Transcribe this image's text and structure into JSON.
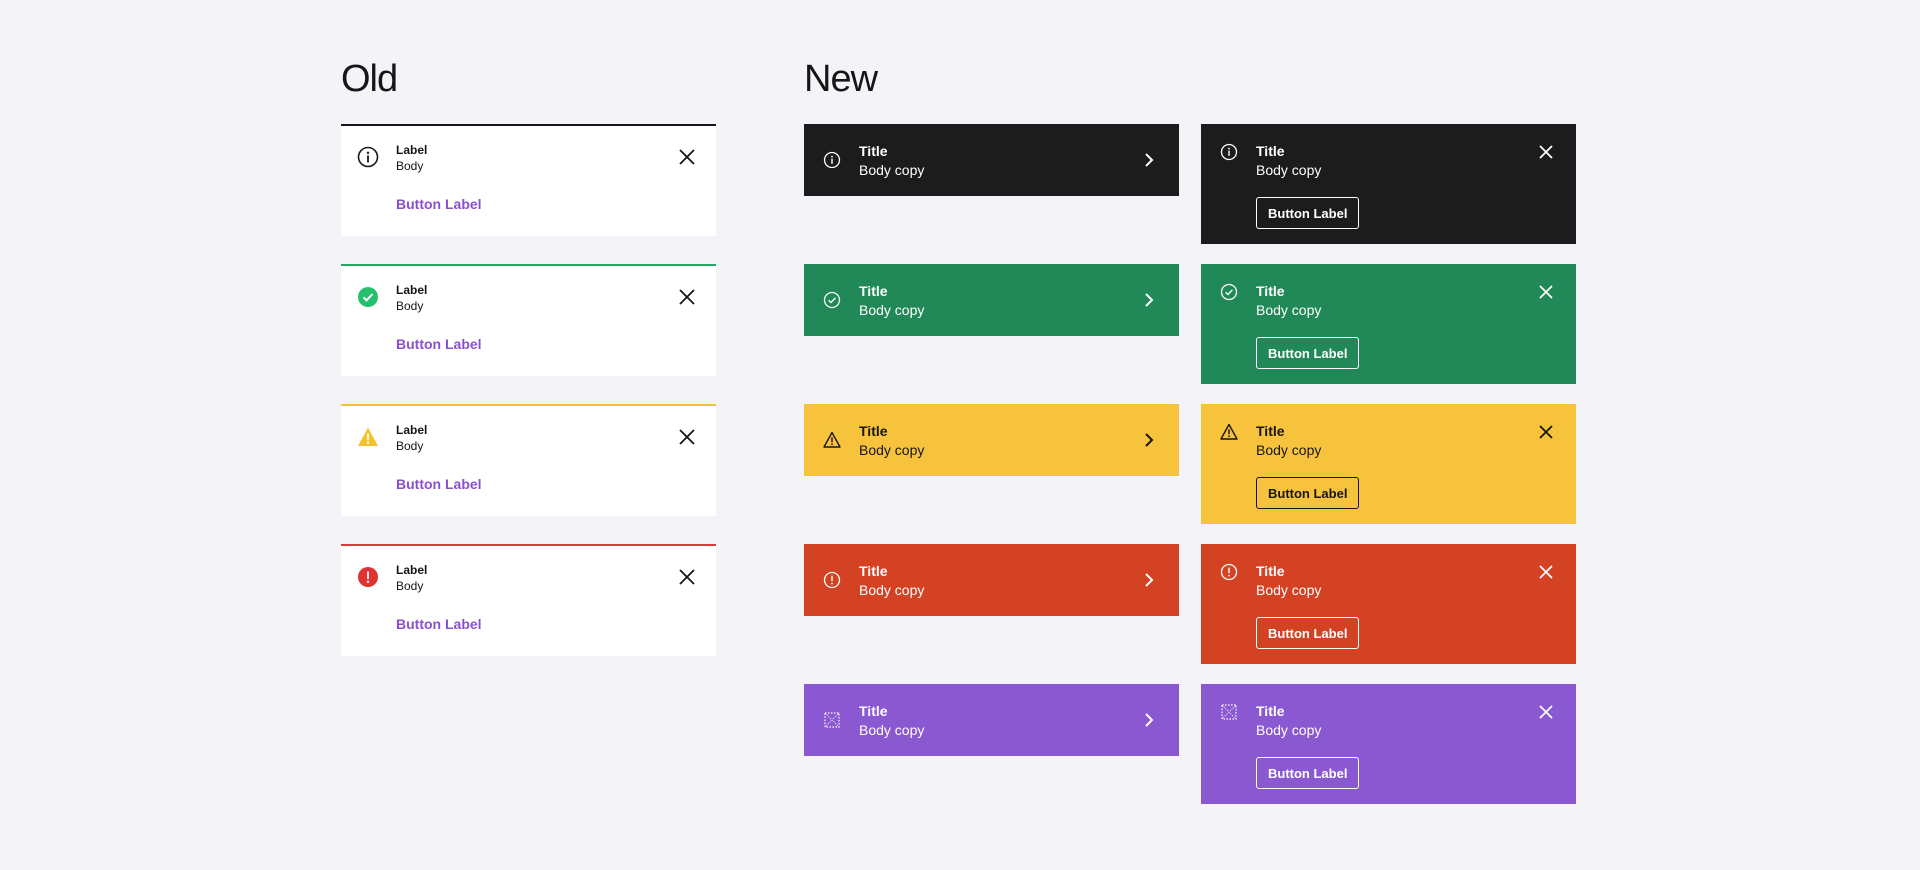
{
  "headings": {
    "old": "Old",
    "new": "New"
  },
  "colors": {
    "neutral": "#1c1c1c",
    "success": "#218957",
    "warning": "#f7c23c",
    "error": "#d44224",
    "info": "#8a58d1",
    "old_neutral_border": "#161616",
    "old_success_border": "#24a560",
    "old_warning_border": "#f2c230",
    "old_error_border": "#d63a3a",
    "old_button_text": "#8a4fd1"
  },
  "old": {
    "items": [
      {
        "variant": "neutral",
        "icon": "info-icon",
        "label": "Label",
        "body": "Body",
        "button": "Button Label"
      },
      {
        "variant": "success",
        "icon": "check-circle-icon",
        "label": "Label",
        "body": "Body",
        "button": "Button Label"
      },
      {
        "variant": "warning",
        "icon": "warning-triangle-icon",
        "label": "Label",
        "body": "Body",
        "button": "Button Label"
      },
      {
        "variant": "error",
        "icon": "error-circle-icon",
        "label": "Label",
        "body": "Body",
        "button": "Button Label"
      }
    ]
  },
  "new": {
    "compact": [
      {
        "variant": "neutral",
        "icon": "info-icon",
        "title": "Title",
        "body": "Body copy"
      },
      {
        "variant": "success",
        "icon": "check-circle-icon",
        "title": "Title",
        "body": "Body copy"
      },
      {
        "variant": "warning",
        "icon": "warning-triangle-icon",
        "title": "Title",
        "body": "Body copy"
      },
      {
        "variant": "error",
        "icon": "error-circle-icon",
        "title": "Title",
        "body": "Body copy"
      },
      {
        "variant": "info",
        "icon": "dotted-square-icon",
        "title": "Title",
        "body": "Body copy"
      }
    ],
    "expanded": [
      {
        "variant": "neutral",
        "icon": "info-icon",
        "title": "Title",
        "body": "Body copy",
        "button": "Button Label"
      },
      {
        "variant": "success",
        "icon": "check-circle-icon",
        "title": "Title",
        "body": "Body copy",
        "button": "Button Label"
      },
      {
        "variant": "warning",
        "icon": "warning-triangle-icon",
        "title": "Title",
        "body": "Body copy",
        "button": "Button Label"
      },
      {
        "variant": "error",
        "icon": "error-circle-icon",
        "title": "Title",
        "body": "Body copy",
        "button": "Button Label"
      },
      {
        "variant": "info",
        "icon": "dotted-square-icon",
        "title": "Title",
        "body": "Body copy",
        "button": "Button Label"
      }
    ]
  }
}
